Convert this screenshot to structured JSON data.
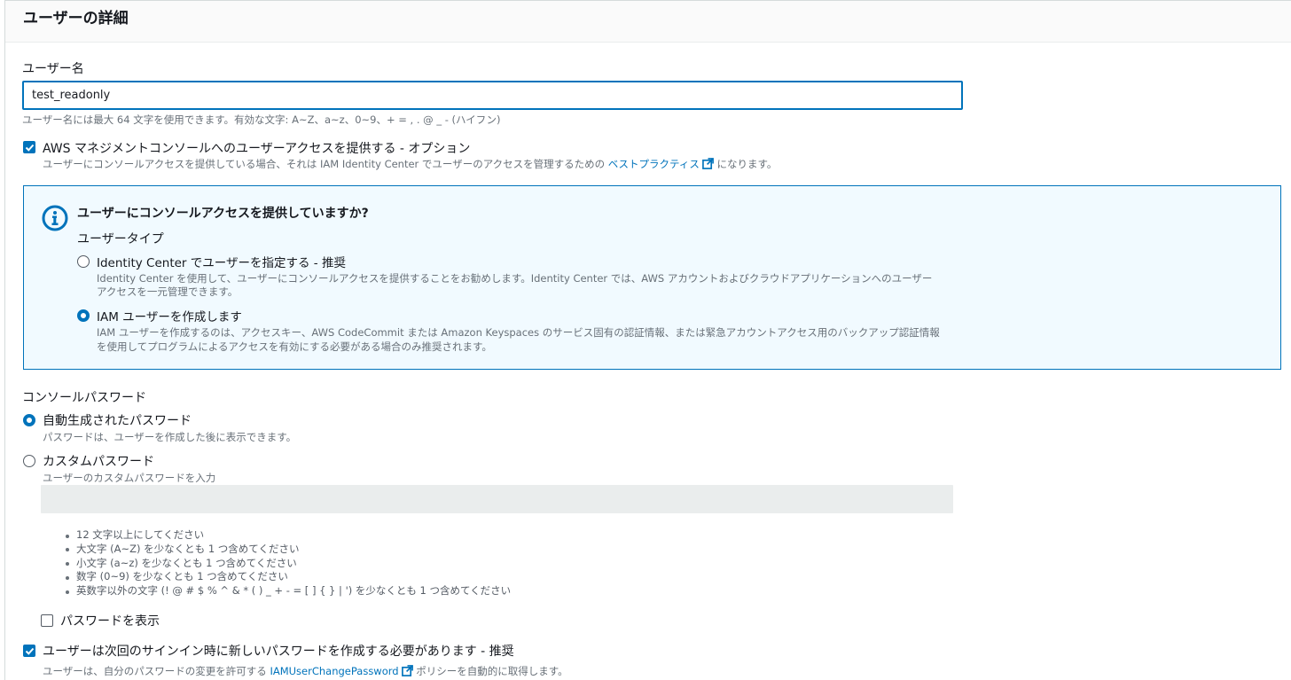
{
  "header": {
    "title": "ユーザーの詳細"
  },
  "username": {
    "label": "ユーザー名",
    "value": "test_readonly",
    "hint": "ユーザー名には最大 64 文字を使用できます。有効な文字: A~Z、a~z、0~9、+ = , . @ _ - (ハイフン)"
  },
  "console_access": {
    "checked": true,
    "label": "AWS マネジメントコンソールへのユーザーアクセスを提供する - オプション",
    "desc_prefix": "ユーザーにコンソールアクセスを提供している場合、それは IAM Identity Center でユーザーのアクセスを管理するための",
    "desc_link": "ベストプラクティス",
    "desc_suffix": "になります。"
  },
  "info_box": {
    "icon": "info-icon",
    "title": "ユーザーにコンソールアクセスを提供していますか?",
    "user_type_label": "ユーザータイプ",
    "options": [
      {
        "selected": false,
        "label": "Identity Center でユーザーを指定する - 推奨",
        "desc_line1": "Identity Center を使用して、ユーザーにコンソールアクセスを提供することをお勧めします。Identity Center では、AWS アカウントおよびクラウドアプリケーションへのユーザー",
        "desc_line2": "アクセスを一元管理できます。"
      },
      {
        "selected": true,
        "label": "IAM ユーザーを作成します",
        "desc_line1": "IAM ユーザーを作成するのは、アクセスキー、AWS CodeCommit または Amazon Keyspaces のサービス固有の認証情報、または緊急アカウントアクセス用のバックアップ認証情報",
        "desc_line2": "を使用してプログラムによるアクセスを有効にする必要がある場合のみ推奨されます。"
      }
    ]
  },
  "password": {
    "label": "コンソールパスワード",
    "auto": {
      "selected": true,
      "label": "自動生成されたパスワード",
      "desc": "パスワードは、ユーザーを作成した後に表示できます。"
    },
    "custom": {
      "selected": false,
      "label": "カスタムパスワード",
      "desc": "ユーザーのカスタムパスワードを入力",
      "value": ""
    },
    "rules": [
      "12 文字以上にしてください",
      "大文字 (A~Z) を少なくとも 1 つ含めてください",
      "小文字 (a~z) を少なくとも 1 つ含めてください",
      "数字 (0~9) を少なくとも 1 つ含めてください",
      "英数字以外の文字 (! @ # $ % ^ & * ( ) _ + - = [ ] { } | ') を少なくとも 1 つ含めてください"
    ],
    "show_password": {
      "checked": false,
      "label": "パスワードを表示"
    }
  },
  "require_reset": {
    "checked": true,
    "label": "ユーザーは次回のサインイン時に新しいパスワードを作成する必要があります - 推奨",
    "desc_prefix": "ユーザーは、自分のパスワードの変更を許可する",
    "desc_link": "IAMUserChangePassword",
    "desc_suffix": "ポリシーを自動的に取得します。"
  },
  "colors": {
    "accent": "#0073bb",
    "info_bg": "#f1faff",
    "text": "#16191f",
    "secondary_text": "#687078"
  }
}
